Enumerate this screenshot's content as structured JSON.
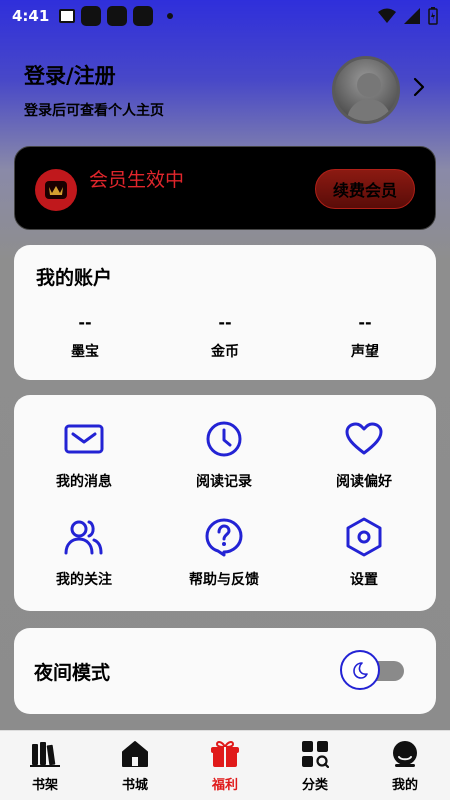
{
  "status_bar": {
    "time": "4:41"
  },
  "header": {
    "title": "登录/注册",
    "subtitle": "登录后可查看个人主页"
  },
  "vip": {
    "status": "会员生效中",
    "button": "续费会员"
  },
  "account": {
    "title": "我的账户",
    "stats": [
      {
        "value": "--",
        "label": "墨宝"
      },
      {
        "value": "--",
        "label": "金币"
      },
      {
        "value": "--",
        "label": "声望"
      }
    ]
  },
  "menu": {
    "items": [
      {
        "label": "我的消息",
        "icon": "mail-icon"
      },
      {
        "label": "阅读记录",
        "icon": "clock-icon"
      },
      {
        "label": "阅读偏好",
        "icon": "heart-icon"
      },
      {
        "label": "我的关注",
        "icon": "users-icon"
      },
      {
        "label": "帮助与反馈",
        "icon": "help-icon"
      },
      {
        "label": "设置",
        "icon": "settings-icon"
      }
    ]
  },
  "night_mode": {
    "label": "夜间模式",
    "enabled": false
  },
  "tabbar": {
    "active": "福利",
    "tabs": [
      {
        "label": "书架",
        "icon": "bookshelf-icon"
      },
      {
        "label": "书城",
        "icon": "home-icon"
      },
      {
        "label": "福利",
        "icon": "gift-icon"
      },
      {
        "label": "分类",
        "icon": "category-icon"
      },
      {
        "label": "我的",
        "icon": "profile-icon"
      }
    ]
  },
  "colors": {
    "accent": "#2323d4",
    "vip_red": "#e0262c",
    "active_tab": "#e01a1a"
  }
}
